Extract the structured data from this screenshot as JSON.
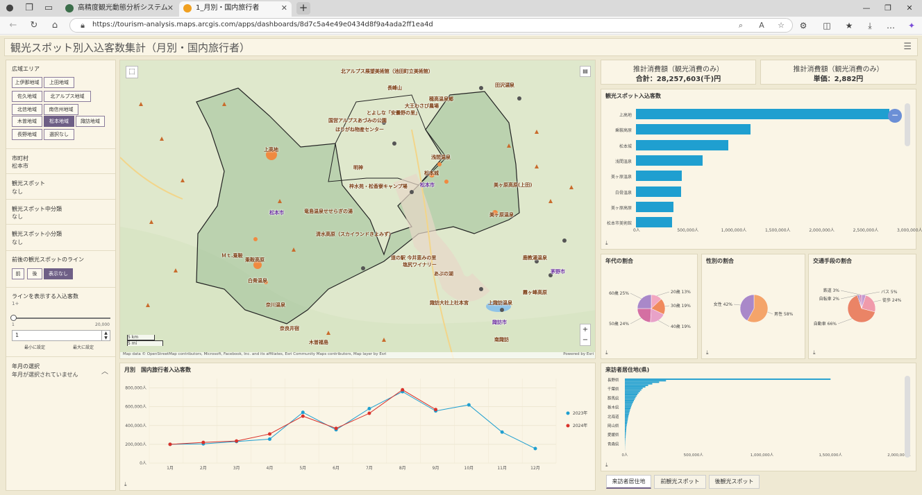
{
  "browser": {
    "tabs": [
      {
        "label": "高精度観光動態分析システム",
        "active": false
      },
      {
        "label": "1_月別・国内旅行者",
        "active": true
      }
    ],
    "url": "https://tourism-analysis.maps.arcgis.com/apps/dashboards/8d7c5a4e49e0434d8f9a4ada2ff1ea4d"
  },
  "header": {
    "title": "観光スポット別入込客数集計（月別・国内旅行者）"
  },
  "filters": {
    "area_label": "広域エリア",
    "areas": [
      {
        "label": "上伊那地域",
        "selected": false
      },
      {
        "label": "上田地域",
        "selected": false
      },
      {
        "label": "佐久地域",
        "selected": false
      },
      {
        "label": "北アルプス地域",
        "selected": false
      },
      {
        "label": "北信地域",
        "selected": false
      },
      {
        "label": "南信州地域",
        "selected": false
      },
      {
        "label": "木曽地域",
        "selected": false
      },
      {
        "label": "松本地域",
        "selected": true
      },
      {
        "label": "諏訪地域",
        "selected": false
      },
      {
        "label": "長野地域",
        "selected": false
      },
      {
        "label": "選択なし",
        "selected": false
      }
    ],
    "city_label": "市町村",
    "city_value": "松本市",
    "spot_label": "観光スポット",
    "spot_value": "なし",
    "mid_label": "観光スポット中分類",
    "mid_value": "なし",
    "small_label": "観光スポット小分類",
    "small_value": "なし",
    "line_label": "前後の観光スポットのライン",
    "line_options": [
      {
        "label": "前",
        "selected": false
      },
      {
        "label": "後",
        "selected": false
      },
      {
        "label": "表示なし",
        "selected": true
      }
    ],
    "visitors_label": "ラインを表示する入込客数",
    "visitors_current": "1+",
    "slider_min": "1",
    "slider_max": "20,000",
    "input_value": "1",
    "set_min": "最小に設定",
    "set_max": "最大に設定",
    "ym_label": "年月の選択",
    "ym_value": "年月が選択されていません"
  },
  "map": {
    "labels": [
      "北アルプス展望美術館（池田町立美術館）",
      "田沢温泉",
      "長峰山",
      "とよしな「安曇野の里」",
      "穂高温泉郷",
      "大王わさび農場",
      "国営アルプスあづみの公園",
      "ほりがね物産センター",
      "上高地",
      "明神",
      "松本城",
      "浅間温泉",
      "梓水苑・松香寮キャンプ場",
      "美ヶ原高原(上田)",
      "美ヶ原温泉",
      "乗鞍高原",
      "白骨温泉",
      "松本市",
      "竜島温泉せせらぎの湯",
      "道の駅 今井恵みの里",
      "奈川温泉",
      "塩尻ワイナリー",
      "あぶの湖",
      "上諏訪温泉",
      "諏訪市",
      "霧ヶ峰高原",
      "鹿教湯温泉",
      "茅野市",
      "奈良井宿",
      "諏訪大社上社本宮",
      "木曽福島",
      "南諏訪",
      "清水高原（スカイランドきよみず）",
      "Ｍｔ.乗鞍",
      "松本市"
    ],
    "scale_km": "5 km",
    "scale_mi": "5 mi",
    "attribution": "Map data © OpenStreetMap contributors, Microsoft, Facebook, Inc. and its affiliates, Esri Community Maps contributors, Map layer by Esri",
    "powered": "Powered by Esri"
  },
  "kpis": [
    {
      "header": "推計消費額（観光消費のみ）",
      "value": "合計：28,257,603(千)円"
    },
    {
      "header": "推計消費額（観光消費のみ）",
      "value": "単価：2,882円"
    }
  ],
  "panels": {
    "spot_title": "観光スポット入込客数",
    "age_title": "年代の割合",
    "gender_title": "性別の割合",
    "transport_title": "交通手段の割合",
    "monthly_title": "月別　国内旅行者入込客数",
    "residence_title": "来訪者居住地(県)"
  },
  "chart_data": [
    {
      "type": "bar",
      "orientation": "horizontal",
      "title": "観光スポット入込客数",
      "categories": [
        "上高地",
        "乗鞍高原",
        "松本城",
        "浅間温泉",
        "美ヶ原温泉",
        "白骨温泉",
        "美ヶ原高原",
        "松本市美術館"
      ],
      "values": [
        2880000,
        1300000,
        1050000,
        760000,
        520000,
        510000,
        430000,
        410000
      ],
      "xticks": [
        "0人",
        "500,000人",
        "1,000,000人",
        "1,500,000人",
        "2,000,000人",
        "2,500,000人",
        "3,000,000人"
      ],
      "xlim": [
        0,
        3000000
      ]
    },
    {
      "type": "pie",
      "title": "年代の割合",
      "slices": [
        {
          "label": "20歳 13%",
          "value": 13,
          "color": "#f2a7c0"
        },
        {
          "label": "30歳 19%",
          "value": 19,
          "color": "#f08a5d"
        },
        {
          "label": "40歳 19%",
          "value": 19,
          "color": "#e8a2c8"
        },
        {
          "label": "50歳 24%",
          "value": 24,
          "color": "#d46fa2"
        },
        {
          "label": "60歳 25%",
          "value": 25,
          "color": "#a988c9"
        }
      ]
    },
    {
      "type": "pie",
      "title": "性別の割合",
      "slices": [
        {
          "label": "男性 58%",
          "value": 58,
          "color": "#f4a46a"
        },
        {
          "label": "女性 42%",
          "value": 42,
          "color": "#a988c9"
        }
      ]
    },
    {
      "type": "pie",
      "title": "交通手段の割合",
      "slices": [
        {
          "label": "バス 5%",
          "value": 5,
          "color": "#c49ad0"
        },
        {
          "label": "徒歩 24%",
          "value": 24,
          "color": "#f09aab"
        },
        {
          "label": "自動車 66%",
          "value": 66,
          "color": "#ea8466"
        },
        {
          "label": "自転車 2%",
          "value": 2,
          "color": "#9a7ec2"
        },
        {
          "label": "鉄道 3%",
          "value": 3,
          "color": "#d48fc0"
        }
      ]
    },
    {
      "type": "line",
      "title": "月別　国内旅行者入込客数",
      "categories": [
        "1月",
        "2月",
        "3月",
        "4月",
        "5月",
        "6月",
        "7月",
        "8月",
        "9月",
        "10月",
        "11月",
        "12月"
      ],
      "yticks": [
        "0人",
        "200,000人",
        "400,000人",
        "600,000人",
        "800,000人"
      ],
      "ylim": [
        0,
        900000
      ],
      "series": [
        {
          "name": "2023年",
          "color": "#1f9fd0",
          "values": [
            200000,
            205000,
            230000,
            255000,
            540000,
            355000,
            580000,
            760000,
            555000,
            620000,
            330000,
            155000
          ]
        },
        {
          "name": "2024年",
          "color": "#d9322b",
          "values": [
            200000,
            220000,
            235000,
            310000,
            500000,
            370000,
            530000,
            780000,
            570000,
            null,
            null,
            null
          ]
        }
      ]
    },
    {
      "type": "bar",
      "orientation": "horizontal",
      "title": "来訪者居住地(県)",
      "categories": [
        "長野県",
        "千葉県",
        "群馬県",
        "栃木県",
        "北海道",
        "岡山県",
        "愛媛県",
        "青森県"
      ],
      "values": [
        1500000,
        300000,
        250000,
        200000,
        170000,
        150000,
        130000,
        120000,
        110000,
        100000,
        92000,
        85000,
        78000,
        72000,
        66000,
        60000,
        55000,
        50000,
        46000,
        42000,
        38000,
        35000,
        32000,
        29000,
        26000,
        24000,
        22000,
        20000,
        18000,
        16000,
        14000,
        12000,
        11000,
        10000,
        9000,
        8000,
        7000,
        6000,
        5000,
        4000,
        3000,
        2500,
        2000,
        1500,
        1000,
        800,
        500
      ],
      "xticks": [
        "0人",
        "500,000人",
        "1,000,000人",
        "1,500,000人",
        "2,000,000人"
      ],
      "xlim": [
        0,
        2000000
      ]
    }
  ],
  "bottom_tabs": [
    {
      "label": "来訪者居住地",
      "selected": true
    },
    {
      "label": "前観光スポット",
      "selected": false
    },
    {
      "label": "後観光スポット",
      "selected": false
    }
  ]
}
